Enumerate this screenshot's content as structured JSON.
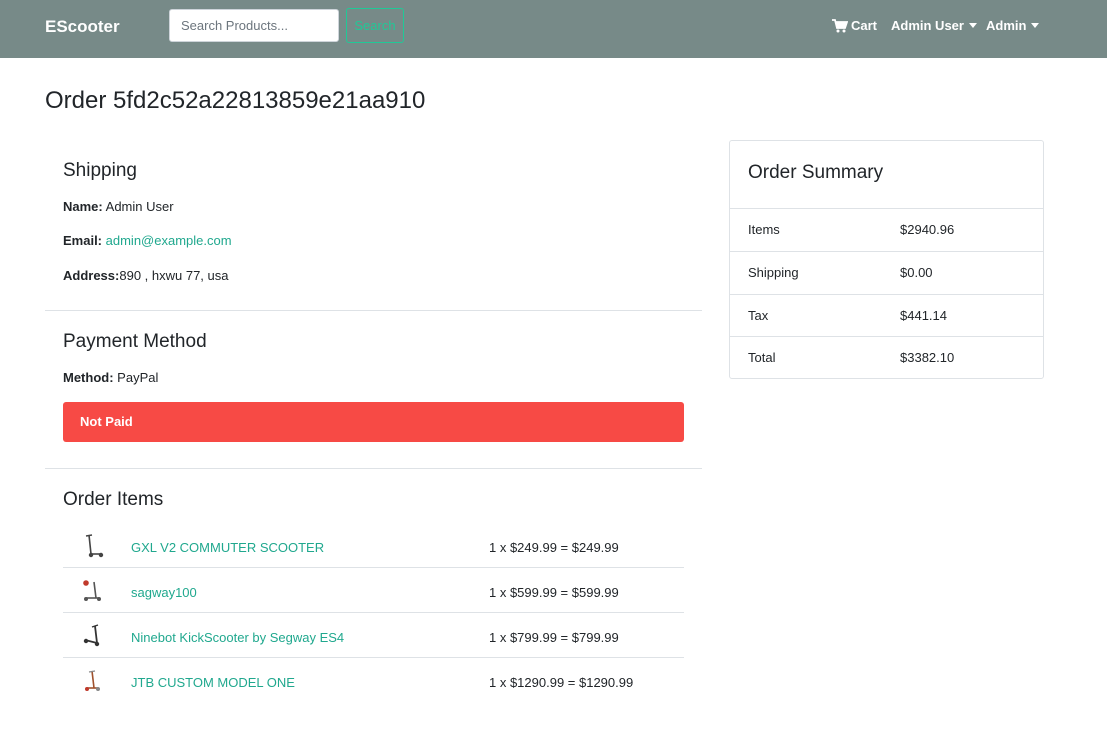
{
  "navbar": {
    "brand": "EScooter",
    "search_placeholder": "Search Products...",
    "search_button": "Search",
    "cart_label": "Cart",
    "user_menu": "Admin User",
    "admin_menu": "Admin"
  },
  "order": {
    "title": "Order 5fd2c52a22813859e21aa910"
  },
  "shipping": {
    "heading": "Shipping",
    "name_label": "Name:",
    "name_value": "Admin User",
    "email_label": "Email:",
    "email_value": "admin@example.com",
    "address_label": "Address:",
    "address_value": "890 , hxwu 77, usa"
  },
  "payment": {
    "heading": "Payment Method",
    "method_label": "Method:",
    "method_value": "PayPal",
    "status": "Not Paid",
    "status_color": "#f74a45"
  },
  "order_items": {
    "heading": "Order Items",
    "items": [
      {
        "name": "GXL V2 COMMUTER SCOOTER",
        "calc": "1 x $249.99 = $249.99"
      },
      {
        "name": "sagway100",
        "calc": "1 x $599.99 = $599.99"
      },
      {
        "name": "Ninebot KickScooter by Segway ES4",
        "calc": "1 x $799.99 = $799.99"
      },
      {
        "name": "JTB CUSTOM MODEL ONE",
        "calc": "1 x $1290.99 = $1290.99"
      }
    ]
  },
  "summary": {
    "heading": "Order Summary",
    "rows": [
      {
        "label": "Items",
        "value": "$2940.96"
      },
      {
        "label": "Shipping",
        "value": "$0.00"
      },
      {
        "label": "Tax",
        "value": "$441.14"
      },
      {
        "label": "Total",
        "value": "$3382.10"
      }
    ]
  },
  "colors": {
    "navbar": "#778a88",
    "accent": "#20c997",
    "link": "#20a88e"
  }
}
